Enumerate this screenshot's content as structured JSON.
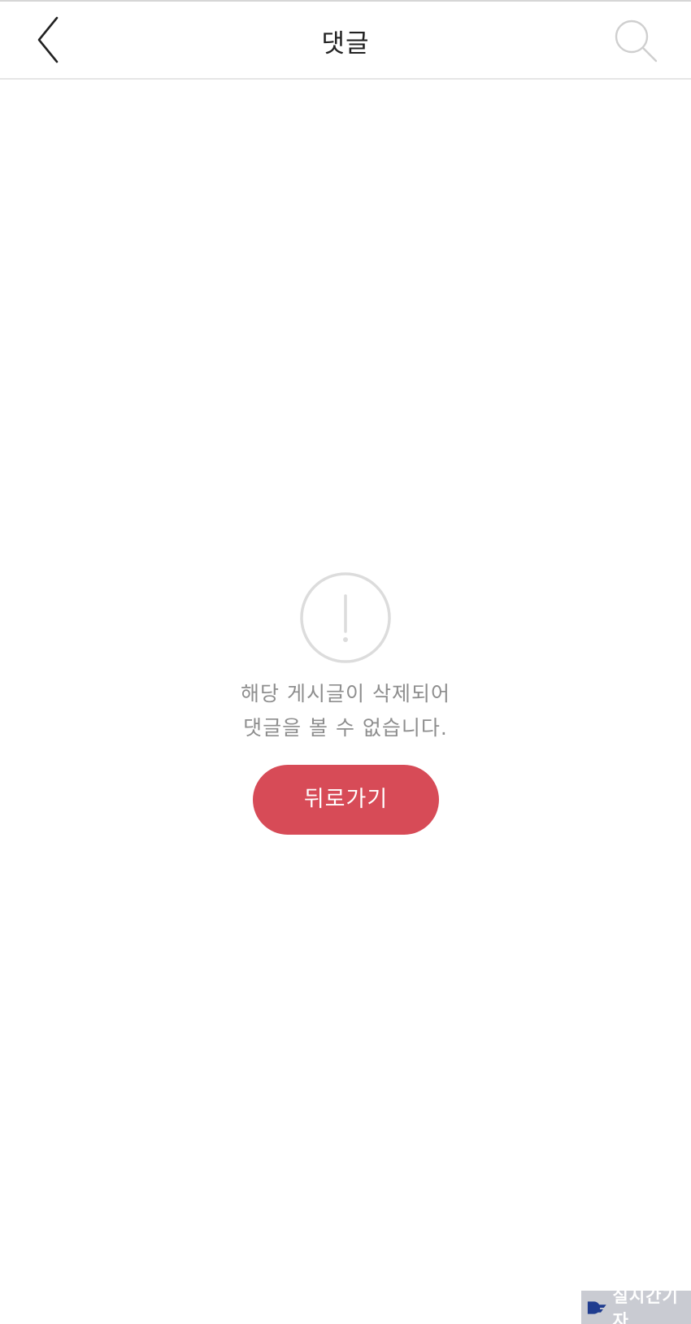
{
  "header": {
    "title": "댓글",
    "back_icon": "chevron-left-icon",
    "search_icon": "search-icon"
  },
  "empty_state": {
    "icon": "exclamation-circle-icon",
    "message_line1": "해당 게시글이 삭제되어",
    "message_line2": "댓글을 볼 수 없습니다.",
    "button_label": "뒤로가기"
  },
  "watermark": {
    "text": "실시간기자",
    "logo_icon": "dc-logo-icon"
  },
  "colors": {
    "accent": "#d74b57",
    "message_text": "#8e8e8e",
    "icon_gray": "#dcdcdc",
    "watermark_bg": "#c9cbd2",
    "logo_blue": "#1f3c8f"
  }
}
